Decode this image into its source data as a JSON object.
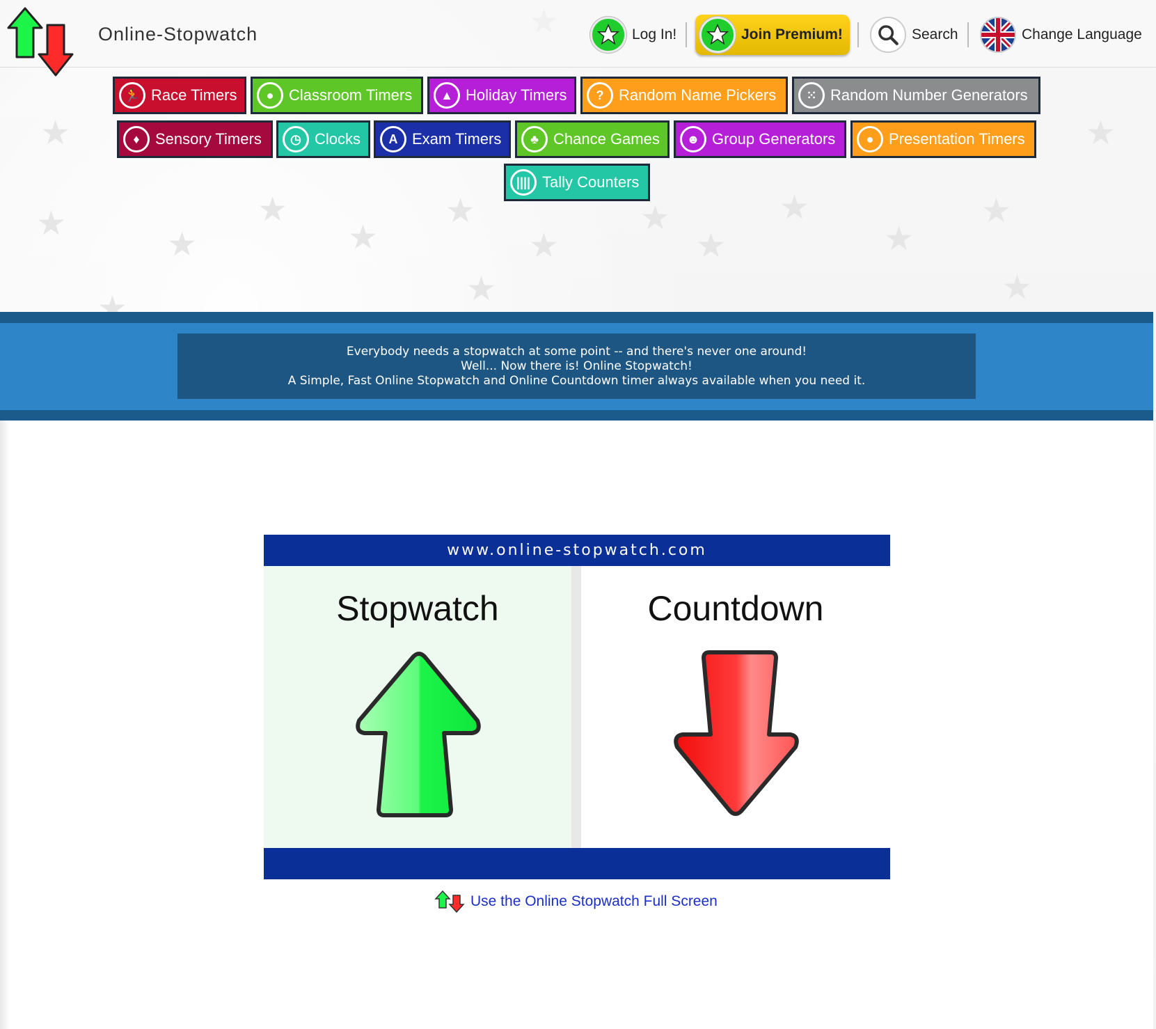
{
  "header": {
    "site_name": "Online-Stopwatch",
    "login_label": "Log In!",
    "premium_label": "Join Premium!",
    "search_label": "Search",
    "language_label": "Change Language"
  },
  "nav": {
    "row1": [
      {
        "label": "Race Timers",
        "icon": "runner-icon",
        "color": "#c8102e"
      },
      {
        "label": "Classroom Timers",
        "icon": "apple-icon",
        "color": "#5ec626"
      },
      {
        "label": "Holiday Timers",
        "icon": "party-hat-icon",
        "color": "#b51fd8"
      },
      {
        "label": "Random Name Pickers",
        "icon": "question-icon",
        "color": "#ff9e1b"
      },
      {
        "label": "Random Number Generators",
        "icon": "dice-icon",
        "color": "#8a8c8e"
      }
    ],
    "row2": [
      {
        "label": "Sensory Timers",
        "icon": "drop-icon",
        "color": "#a6093d"
      },
      {
        "label": "Clocks",
        "icon": "clock-icon",
        "color": "#23c7a6"
      },
      {
        "label": "Exam Timers",
        "icon": "a-plus-icon",
        "color": "#1b2fa8"
      },
      {
        "label": "Chance Games",
        "icon": "cherries-icon",
        "color": "#5ec626"
      },
      {
        "label": "Group Generators",
        "icon": "group-icon",
        "color": "#b51fd8"
      },
      {
        "label": "Presentation Timers",
        "icon": "speech-bubble-icon",
        "color": "#ff9e1b"
      }
    ],
    "row3": [
      {
        "label": "Tally Counters",
        "icon": "tally-icon",
        "color": "#23c7a6"
      }
    ]
  },
  "banner": {
    "line1": "Everybody needs a stopwatch at some point -- and there's never one around!",
    "line2": "Well... Now there is! Online Stopwatch!",
    "line3": "A Simple, Fast Online Stopwatch and Online Countdown timer always available when you need it."
  },
  "panel": {
    "url": "www.online-stopwatch.com",
    "stopwatch_label": "Stopwatch",
    "countdown_label": "Countdown"
  },
  "fullscreen_link": "Use the Online Stopwatch Full Screen",
  "colors": {
    "panel_blue": "#0a2f96",
    "banner_blue": "#2e86c8",
    "arrow_green": "#1cf44a",
    "arrow_red": "#ff1f1f"
  }
}
